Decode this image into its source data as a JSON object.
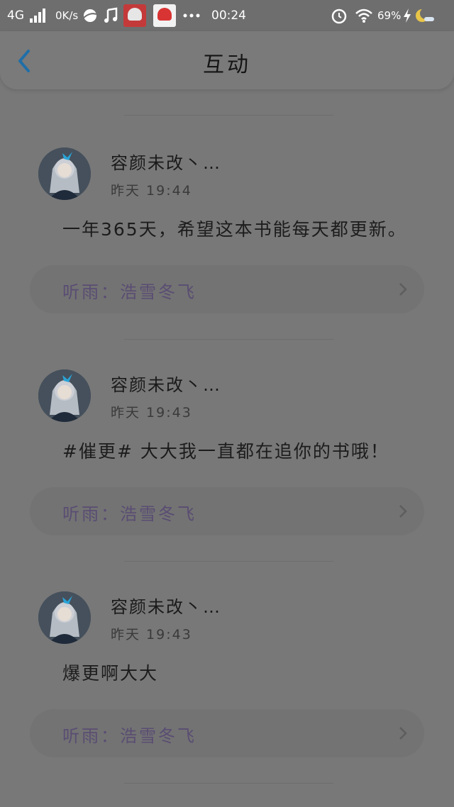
{
  "status_bar": {
    "network": "4G",
    "speed": "0K/s",
    "time": "00:24",
    "battery": "69%",
    "icons": [
      "signal-icon",
      "planet-icon",
      "music-note-icon",
      "app-badge-icon",
      "more-dots-icon",
      "alarm-icon",
      "wifi-icon",
      "charging-icon",
      "moon-icon"
    ]
  },
  "header": {
    "title": "互动",
    "back_icon": "chevron-left-icon",
    "accent": "#1f6ea8"
  },
  "comments": [
    {
      "username": "容颜未改丶…",
      "time": "昨天 19:44",
      "message": "一年365天，希望这本书能每天都更新。",
      "book": "听雨：浩雪冬飞"
    },
    {
      "username": "容颜未改丶…",
      "time": "昨天 19:43",
      "message": "#催更# 大大我一直都在追你的书哦！",
      "book": "听雨：浩雪冬飞"
    },
    {
      "username": "容颜未改丶…",
      "time": "昨天 19:43",
      "message": "爆更啊大大",
      "book": "听雨：浩雪冬飞"
    }
  ],
  "colors": {
    "link_text": "#5a4d73",
    "overlay_bg": "#787878"
  }
}
